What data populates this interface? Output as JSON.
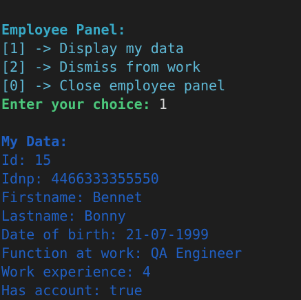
{
  "employee_panel": {
    "title": "Employee Panel:",
    "options": [
      "[1] -> Display my data",
      "[2] -> Dismiss from work",
      "[0] -> Close employee panel"
    ],
    "prompt": "Enter your choice: ",
    "input_value": "1"
  },
  "my_data": {
    "title": "My Data:",
    "fields": [
      "Id: 15",
      "Idnp: 4466333355550",
      "Firstname: Bennet",
      "Lastname: Bonny",
      "Date of birth: 21-07-1999",
      "Function at work: QA Engineer",
      "Work experience: 4",
      "Has account: true"
    ]
  },
  "colors": {
    "background": "#1e1e1e",
    "heading": "#38a9c6",
    "menu": "#5fb9d6",
    "prompt": "#4cc87c",
    "data": "#2160c4"
  }
}
